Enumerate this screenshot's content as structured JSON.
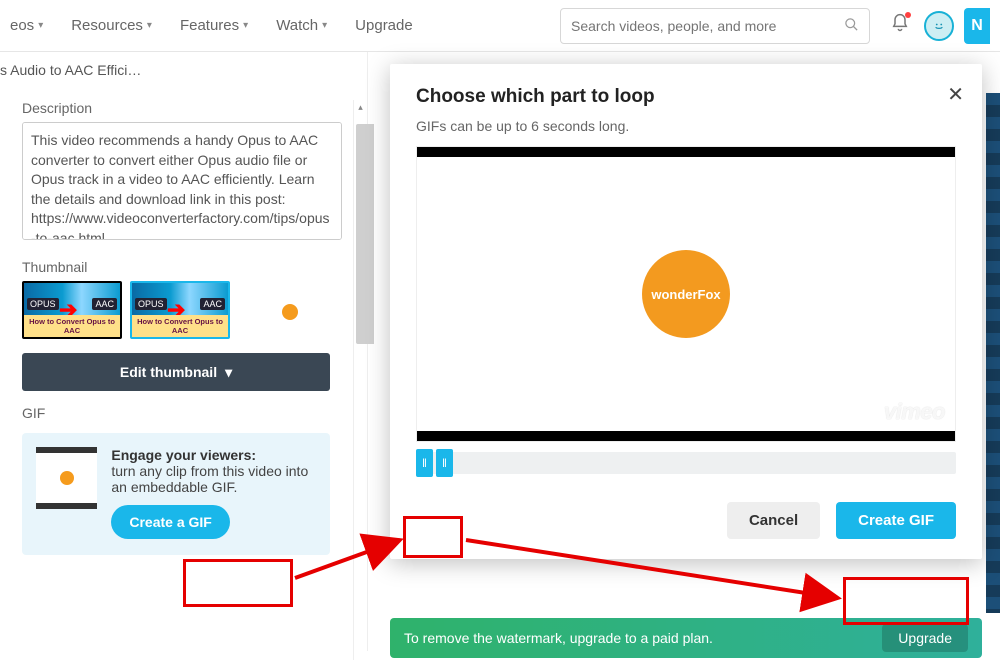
{
  "nav": {
    "items": [
      "eos",
      "Resources",
      "Features",
      "Watch",
      "Upgrade"
    ],
    "search_placeholder": "Search videos, people, and more",
    "new_label": "N"
  },
  "breadcrumb": "s Audio to AAC Effici…",
  "left": {
    "desc_label": "Description",
    "desc_value": "This video recommends a handy Opus to AAC converter to convert either Opus audio file or Opus track in a video to AAC efficiently. Learn the details and download link in this post: https://www.videoconverterfactory.com/tips/opus-to-aac.html",
    "thumb_label": "Thumbnail",
    "thumb_caption": "How to Convert Opus to AAC",
    "thumb_badge_left": "OPUS",
    "thumb_badge_right": "AAC",
    "edit_thumbnail": "Edit thumbnail",
    "gif_label": "GIF",
    "gif_heading": "Engage your viewers:",
    "gif_body": "turn any clip from this video into an embeddable GIF.",
    "create_a_gif": "Create a GIF"
  },
  "modal": {
    "title": "Choose which part to loop",
    "subtitle": "GIFs can be up to 6 seconds long.",
    "brand": "wonderFox",
    "watermark": "vimeo",
    "cancel": "Cancel",
    "create": "Create GIF"
  },
  "upgrade": {
    "msg": "To remove the watermark, upgrade to a paid plan.",
    "btn": "Upgrade"
  }
}
